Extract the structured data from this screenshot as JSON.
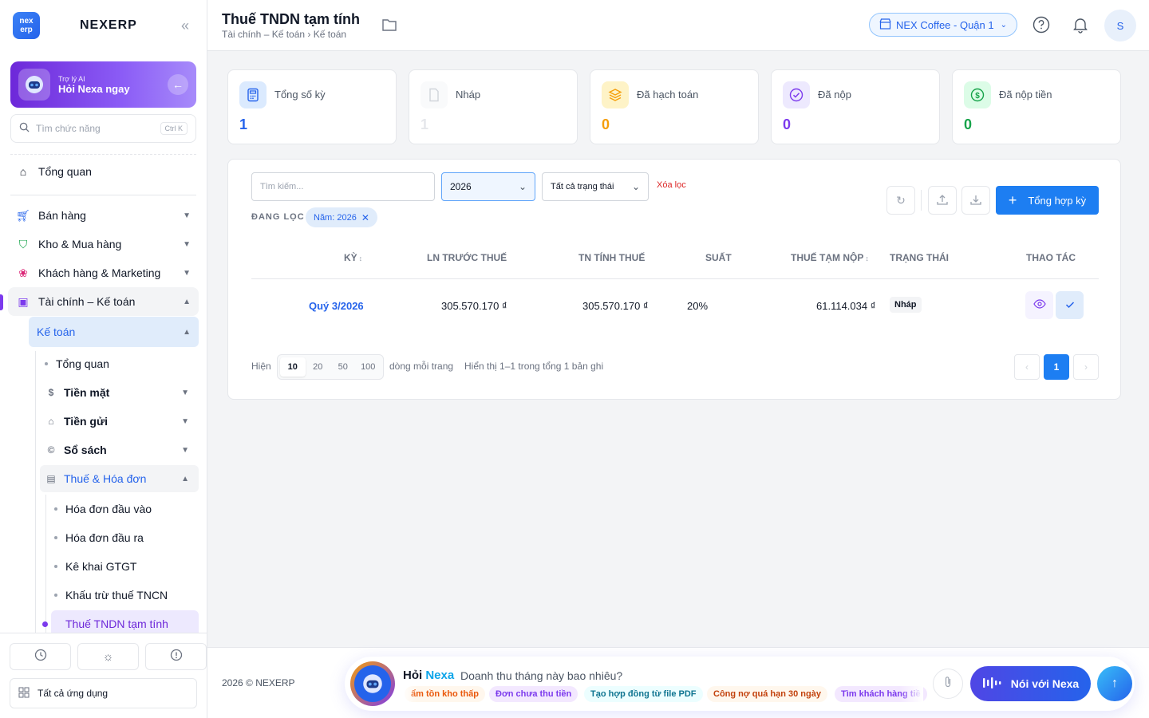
{
  "sidebar": {
    "logo": {
      "line1": "nex",
      "line2": "erp"
    },
    "brand": "NEXERP",
    "collapse_icon": "«",
    "ai": {
      "sub": "Trợ lý AI",
      "main": "Hỏi Nexa ngay"
    },
    "search": {
      "placeholder": "Tìm chức năng",
      "shortcut": "Ctrl K"
    },
    "overview": "Tổng quan",
    "items": [
      {
        "label": "Bán hàng"
      },
      {
        "label": "Kho & Mua hàng"
      },
      {
        "label": "Khách hàng & Marketing"
      },
      {
        "label": "Tài chính – Kế toán"
      }
    ],
    "ketoan": "Kế toán",
    "ketoan_children": [
      {
        "label": "Tổng quan"
      },
      {
        "label": "Tiền mặt"
      },
      {
        "label": "Tiền gửi"
      },
      {
        "label": "Sổ sách"
      },
      {
        "label": "Thuế & Hóa đơn"
      }
    ],
    "tax_children": [
      {
        "label": "Hóa đơn đầu vào"
      },
      {
        "label": "Hóa đơn đầu ra"
      },
      {
        "label": "Kê khai GTGT"
      },
      {
        "label": "Khấu trừ thuế TNCN"
      },
      {
        "label": "Thuế TNDN tạm tính"
      }
    ],
    "all_apps": "Tất cả ứng dụng"
  },
  "header": {
    "title": "Thuế TNDN tạm tính",
    "breadcrumb": "Tài chính – Kế toán › Kế toán",
    "store": "NEX Coffee - Quận 1",
    "avatar": "S"
  },
  "stats": [
    {
      "label": "Tổng số kỳ",
      "value": "1",
      "color": "#2563eb"
    },
    {
      "label": "Nháp",
      "value": "1",
      "color": "#e5e7eb"
    },
    {
      "label": "Đã hạch toán",
      "value": "0",
      "color": "#f59e0b"
    },
    {
      "label": "Đã nộp",
      "value": "0",
      "color": "#7c3aed"
    },
    {
      "label": "Đã nộp tiền",
      "value": "0",
      "color": "#16a34a"
    }
  ],
  "filters": {
    "search_placeholder": "Tìm kiếm...",
    "year": "2026",
    "status": "Tất cả trạng thái",
    "clear": "Xóa lọc",
    "active_label": "ĐANG LỌC",
    "chip": "Năm: 2026",
    "primary": "Tổng hợp kỳ"
  },
  "table": {
    "headers": [
      "KỲ",
      "LN TRƯỚC THUẾ",
      "TN TÍNH THUẾ",
      "SUẤT",
      "THUẾ TẠM NỘP",
      "TRẠNG THÁI",
      "THAO TÁC"
    ],
    "rows": [
      {
        "period": "Quý 3/2026",
        "profit": "305.570.170 ₫",
        "taxable": "305.570.170 ₫",
        "rate": "20%",
        "tax": "61.114.034 ₫",
        "status": "Nháp"
      }
    ]
  },
  "pagination": {
    "show": "Hiện",
    "sizes": [
      "10",
      "20",
      "50",
      "100"
    ],
    "per_page": "dòng mỗi trang",
    "summary": "Hiển thị 1–1 trong tổng 1 bản ghi",
    "current": "1"
  },
  "footer": {
    "copyright": "2026 © NEXERP",
    "ask": "Hỏi",
    "nexa": "Nexa",
    "question": "Doanh thu tháng này bao nhiêu?",
    "chips": [
      {
        "label": "ẩm tồn kho thấp",
        "bg": "#fff7ed",
        "fg": "#ea580c"
      },
      {
        "label": "Đơn chưa thu tiền",
        "bg": "#f3e8ff",
        "fg": "#7c3aed"
      },
      {
        "label": "Tạo hợp đồng từ file PDF",
        "bg": "#ecfeff",
        "fg": "#0e7490"
      },
      {
        "label": "Công nợ quá hạn 30 ngày",
        "bg": "#fff7ed",
        "fg": "#c2410c"
      },
      {
        "label": "Tìm khách hàng tiề",
        "bg": "#f3e8ff",
        "fg": "#7c3aed"
      }
    ],
    "talk": "Nói với Nexa"
  }
}
